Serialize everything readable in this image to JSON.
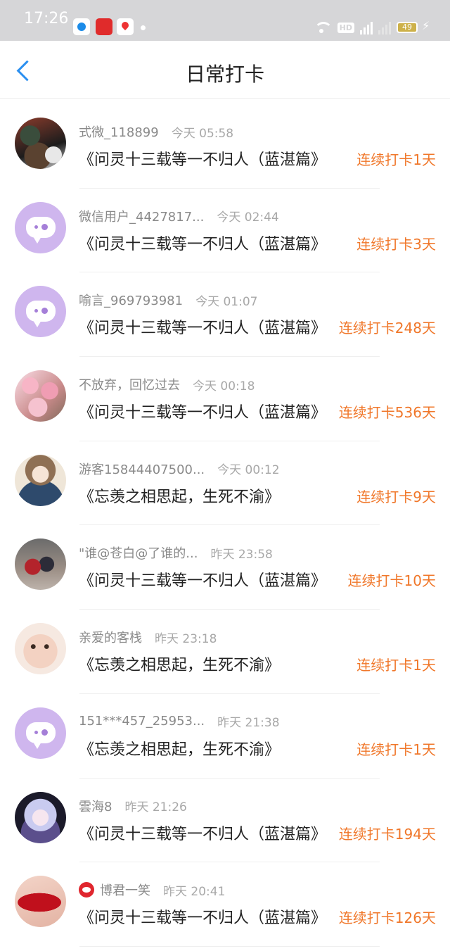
{
  "status_bar": {
    "time": "17:26",
    "network": "4G",
    "battery": "49"
  },
  "nav": {
    "title": "日常打卡"
  },
  "checkins": [
    {
      "name": "式微_118899",
      "time": "今天 05:58",
      "book": "《问灵十三载等一不归人（蓝湛篇》",
      "streak": "连续打卡1天",
      "avatar": "photo1",
      "vip": false
    },
    {
      "name": "微信用户_4427817...",
      "time": "今天 02:44",
      "book": "《问灵十三载等一不归人（蓝湛篇》",
      "streak": "连续打卡3天",
      "avatar": "default",
      "vip": false
    },
    {
      "name": "喻言_969793981",
      "time": "今天 01:07",
      "book": "《问灵十三载等一不归人（蓝湛篇》",
      "streak": "连续打卡248天",
      "avatar": "default",
      "vip": false
    },
    {
      "name": "不放弃，回忆过去",
      "time": "今天 00:18",
      "book": "《问灵十三载等一不归人（蓝湛篇》",
      "streak": "连续打卡536天",
      "avatar": "blossom",
      "vip": false
    },
    {
      "name": "游客15844407500...",
      "time": "今天 00:12",
      "book": "《忘羡之相思起，生死不渝》",
      "streak": "连续打卡9天",
      "avatar": "girl",
      "vip": false
    },
    {
      "name": "\"谁@苍白@了谁的...",
      "time": "昨天 23:58",
      "book": "《问灵十三载等一不归人（蓝湛篇》",
      "streak": "连续打卡10天",
      "avatar": "kids",
      "vip": false
    },
    {
      "name": "亲爱的客栈",
      "time": "昨天 23:18",
      "book": "《忘羡之相思起，生死不渝》",
      "streak": "连续打卡1天",
      "avatar": "baby",
      "vip": false
    },
    {
      "name": "151***457_25953...",
      "time": "昨天 21:38",
      "book": "《忘羡之相思起，生死不渝》",
      "streak": "连续打卡1天",
      "avatar": "default",
      "vip": false
    },
    {
      "name": "雲海8",
      "time": "昨天 21:26",
      "book": "《问灵十三载等一不归人（蓝湛篇》",
      "streak": "连续打卡194天",
      "avatar": "anime",
      "vip": false
    },
    {
      "name": "博君一笑",
      "time": "昨天 20:41",
      "book": "《问灵十三载等一不归人（蓝湛篇》",
      "streak": "连续打卡126天",
      "avatar": "lips",
      "vip": true
    }
  ]
}
